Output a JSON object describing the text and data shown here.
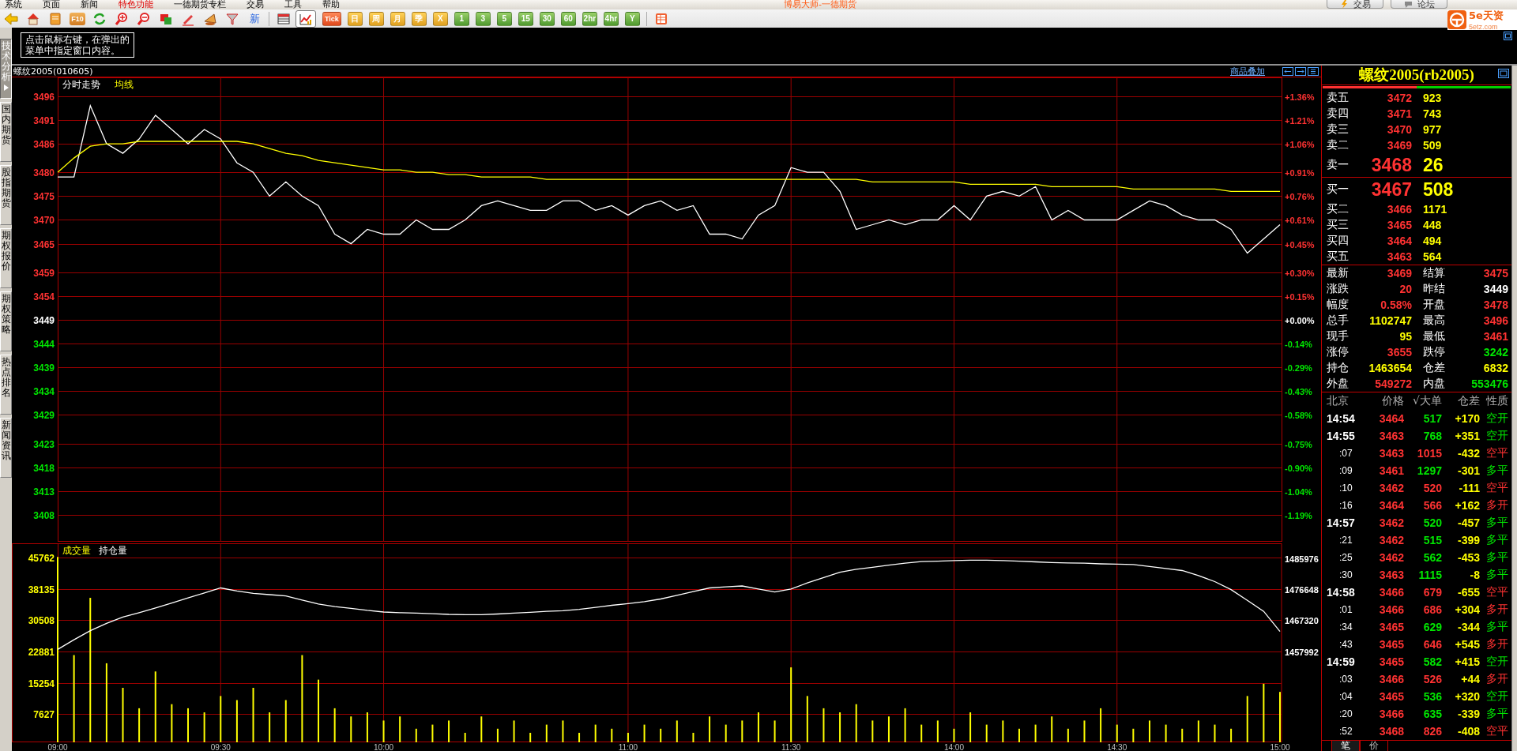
{
  "menu": {
    "items": [
      {
        "label": "系统",
        "highlight": false
      },
      {
        "label": "页面",
        "highlight": false
      },
      {
        "label": "新闻",
        "highlight": false
      },
      {
        "label": "特色功能",
        "highlight": true
      },
      {
        "label": "一德期货专栏",
        "highlight": false
      },
      {
        "label": "交易",
        "highlight": false
      },
      {
        "label": "工具",
        "highlight": false
      },
      {
        "label": "帮助",
        "highlight": false
      }
    ],
    "title": "博易大师-一德期货",
    "buttons": [
      "交易",
      "论坛"
    ]
  },
  "toolbar": {
    "f10_label": "F10",
    "news_label": "新",
    "view_pressed": true,
    "periods": [
      {
        "label": "Tick",
        "kind": "tick"
      },
      {
        "label": "日",
        "kind": "calendar"
      },
      {
        "label": "周",
        "kind": "calendar"
      },
      {
        "label": "月",
        "kind": "calendar"
      },
      {
        "label": "季",
        "kind": "calendar"
      },
      {
        "label": "X",
        "kind": "calendar"
      },
      {
        "label": "1",
        "kind": "minute"
      },
      {
        "label": "3",
        "kind": "minute"
      },
      {
        "label": "5",
        "kind": "minute"
      },
      {
        "label": "15",
        "kind": "minute"
      },
      {
        "label": "30",
        "kind": "minute"
      },
      {
        "label": "60",
        "kind": "minute"
      },
      {
        "label": "2hr",
        "kind": "minute"
      },
      {
        "label": "4hr",
        "kind": "minute"
      },
      {
        "label": "Y",
        "kind": "minute"
      }
    ]
  },
  "logo": {
    "name": "5e天资",
    "site": "5etz.com"
  },
  "side_tabs": [
    {
      "label": "技术分析",
      "selected": true
    },
    {
      "label": "国内期货",
      "selected": false
    },
    {
      "label": "股指期货",
      "selected": false
    },
    {
      "label": "期权报价",
      "selected": false
    },
    {
      "label": "期权策略",
      "selected": false
    },
    {
      "label": "热点排名",
      "selected": false
    },
    {
      "label": "新闻资讯",
      "selected": false
    }
  ],
  "hint": {
    "lines": [
      "点击鼠标右键，在弹出的",
      "菜单中指定窗口内容。"
    ]
  },
  "chart_header": {
    "title": "螺纹2005(010605)",
    "overlay_link": "商品叠加"
  },
  "price_chart": {
    "right_axis": [
      {
        "label": "+1.36%",
        "color": "#ff3232"
      },
      {
        "label": "+1.21%",
        "color": "#ff3232"
      },
      {
        "label": "+1.06%",
        "color": "#ff3232"
      },
      {
        "label": "+0.91%",
        "color": "#ff3232"
      },
      {
        "label": "+0.76%",
        "color": "#ff3232"
      },
      {
        "label": "+0.61%",
        "color": "#ff3232"
      },
      {
        "label": "+0.45%",
        "color": "#ff3232"
      },
      {
        "label": "+0.30%",
        "color": "#ff3232"
      },
      {
        "label": "+0.15%",
        "color": "#ff3232"
      },
      {
        "label": "+0.00%",
        "color": "#ffffff"
      },
      {
        "label": "-0.14%",
        "color": "#00e600"
      },
      {
        "label": "-0.29%",
        "color": "#00e600"
      },
      {
        "label": "-0.43%",
        "color": "#00e600"
      },
      {
        "label": "-0.58%",
        "color": "#00e600"
      },
      {
        "label": "-0.75%",
        "color": "#00e600"
      },
      {
        "label": "-0.90%",
        "color": "#00e600"
      },
      {
        "label": "-1.04%",
        "color": "#00e600"
      },
      {
        "label": "-1.19%",
        "color": "#00e600"
      }
    ],
    "chart_data": {
      "type": "line",
      "grid": true,
      "ylim": [
        3402.36,
        3499.95
      ],
      "yticks": [
        3496,
        3491,
        3486,
        3480,
        3475,
        3470,
        3465,
        3459,
        3454,
        3449,
        3444,
        3439,
        3434,
        3429,
        3423,
        3418,
        3413,
        3408
      ],
      "categories": [
        null,
        null,
        null,
        null,
        null,
        null,
        null,
        null,
        null,
        null,
        null,
        null,
        null,
        null,
        null,
        null,
        null,
        null,
        null,
        null,
        null,
        null,
        null,
        null,
        null,
        null,
        null,
        null,
        null,
        null,
        null,
        null,
        null,
        null,
        null,
        null,
        null,
        null,
        null,
        null,
        null,
        null,
        null,
        null,
        null,
        null,
        null,
        null,
        null,
        null,
        null,
        null,
        null,
        null,
        null,
        null,
        null,
        null,
        null,
        null,
        null,
        null,
        null,
        null,
        null,
        null,
        null,
        null,
        null,
        null,
        null,
        null,
        null,
        null,
        null,
        null
      ],
      "series": [
        {
          "name": "分时走势",
          "color": "#ffffff",
          "values": [
            3479,
            3479,
            3494,
            3486,
            3484,
            3487,
            3492,
            3489,
            3486,
            3489,
            3487,
            3482,
            3480,
            3475,
            3478,
            3475,
            3473,
            3467,
            3465,
            3468,
            3467,
            3467,
            3470,
            3468,
            3468,
            3470,
            3473,
            3474,
            3473,
            3472,
            3472,
            3474,
            3474,
            3472,
            3473,
            3471,
            3473,
            3474,
            3472,
            3473,
            3467,
            3467,
            3466,
            3471,
            3473,
            3481,
            3480,
            3480,
            3476,
            3468,
            3469,
            3470,
            3469,
            3470,
            3470,
            3473,
            3470,
            3475,
            3476,
            3475,
            3477,
            3470,
            3472,
            3470,
            3470,
            3470,
            3472,
            3474,
            3473,
            3471,
            3470,
            3470,
            3468,
            3463,
            3466,
            3469
          ]
        },
        {
          "name": "均线",
          "color": "#ffff00",
          "values": [
            3480,
            3483,
            3485.5,
            3486,
            3486,
            3486.5,
            3486.5,
            3486.5,
            3486.5,
            3486.5,
            3486.5,
            3486.5,
            3486,
            3485,
            3484,
            3483.5,
            3482.5,
            3482,
            3481.5,
            3481,
            3480.5,
            3480.5,
            3480,
            3480,
            3479.5,
            3479.5,
            3479,
            3479,
            3479,
            3479,
            3478.5,
            3478.5,
            3478.5,
            3478.5,
            3478.5,
            3478.5,
            3478.5,
            3478.5,
            3478.5,
            3478.5,
            3478.5,
            3478.5,
            3478.5,
            3478.5,
            3478.5,
            3478.5,
            3478.5,
            3478.5,
            3478.5,
            3478.5,
            3478,
            3478,
            3478,
            3478,
            3478,
            3478,
            3477.5,
            3477.5,
            3477.5,
            3477.5,
            3477.5,
            3477,
            3477,
            3477,
            3477,
            3477,
            3476.5,
            3476.5,
            3476.5,
            3476.5,
            3476.5,
            3476.5,
            3476,
            3476,
            3476,
            3476
          ]
        }
      ]
    }
  },
  "volume_chart": {
    "chart_data": {
      "type": "bar",
      "grid": true,
      "ylim": [
        676,
        49334
      ],
      "categories": [
        "09:00",
        null,
        null,
        null,
        null,
        null,
        null,
        null,
        null,
        null,
        "09:30",
        null,
        null,
        null,
        null,
        null,
        null,
        null,
        null,
        null,
        "10:00",
        null,
        null,
        null,
        null,
        null,
        null,
        null,
        null,
        null,
        null,
        null,
        null,
        null,
        null,
        "11:00",
        null,
        null,
        null,
        null,
        null,
        null,
        null,
        null,
        null,
        "11:30",
        null,
        null,
        null,
        null,
        null,
        null,
        null,
        null,
        null,
        "14:00",
        null,
        null,
        null,
        null,
        null,
        null,
        null,
        null,
        null,
        "14:30",
        null,
        null,
        null,
        null,
        null,
        null,
        null,
        null,
        null,
        "15:00"
      ],
      "yticks": [
        45762,
        38135,
        30508,
        22881,
        15254,
        7627
      ],
      "series": [
        {
          "name": "成交量",
          "color": "#ffff00",
          "values": [
            46000,
            22000,
            36000,
            20000,
            14000,
            9000,
            18000,
            10000,
            9000,
            8000,
            12000,
            11000,
            14000,
            8000,
            11000,
            22000,
            16000,
            9000,
            7000,
            8000,
            6000,
            7000,
            4000,
            5000,
            6000,
            3000,
            7000,
            4000,
            6000,
            3000,
            5000,
            6000,
            3000,
            5000,
            4000,
            3000,
            5000,
            4000,
            6000,
            3000,
            7000,
            5000,
            6000,
            8000,
            6000,
            19000,
            12000,
            9000,
            8000,
            10000,
            6000,
            7000,
            9000,
            5000,
            6000,
            4000,
            8000,
            5000,
            6000,
            4000,
            5000,
            7000,
            4000,
            6000,
            9000,
            5000,
            4000,
            6000,
            5000,
            4000,
            6000,
            5000,
            4000,
            12000,
            15000,
            13000
          ]
        }
      ]
    },
    "open_interest": {
      "chart_data": {
        "type": "line",
        "ylim": [
          1430834,
          1490345
        ],
        "yticks": [
          1485976,
          1476648,
          1467320,
          1457992
        ],
        "categories": [
          null,
          null,
          null,
          null,
          null,
          null,
          null,
          null,
          null,
          null,
          null,
          null,
          null,
          null,
          null,
          null,
          null,
          null,
          null,
          null,
          null,
          null,
          null,
          null,
          null,
          null,
          null,
          null,
          null,
          null,
          null,
          null,
          null,
          null,
          null,
          null,
          null,
          null,
          null,
          null,
          null,
          null,
          null,
          null,
          null,
          null,
          null,
          null,
          null,
          null,
          null,
          null,
          null,
          null,
          null,
          null,
          null,
          null,
          null,
          null,
          null,
          null,
          null,
          null,
          null,
          null,
          null,
          null,
          null,
          null,
          null,
          null,
          null,
          null,
          null,
          null
        ],
        "series": [
          {
            "name": "持仓量",
            "color": "#ffffff",
            "values": [
              1458600,
              1461500,
              1464200,
              1466400,
              1468300,
              1469600,
              1471000,
              1472500,
              1474000,
              1475500,
              1477000,
              1476100,
              1475400,
              1475000,
              1474600,
              1473400,
              1472200,
              1471400,
              1470900,
              1470300,
              1469800,
              1469600,
              1469500,
              1469300,
              1469100,
              1469000,
              1469000,
              1469200,
              1469500,
              1469700,
              1470000,
              1470200,
              1470600,
              1471200,
              1471800,
              1472300,
              1472900,
              1473700,
              1474800,
              1475900,
              1477000,
              1477300,
              1477600,
              1476700,
              1475800,
              1476700,
              1478500,
              1480100,
              1481700,
              1482600,
              1483200,
              1483800,
              1484400,
              1484900,
              1485000,
              1485200,
              1485300,
              1485300,
              1485200,
              1485000,
              1484800,
              1484600,
              1484500,
              1484400,
              1484200,
              1484100,
              1484000,
              1483400,
              1482800,
              1482200,
              1480700,
              1478900,
              1476500,
              1473300,
              1470000,
              1464000
            ]
          }
        ]
      }
    }
  },
  "quote": {
    "title": "螺纹2005(rb2005)",
    "ratio": {
      "level": 0.5
    },
    "asks": [
      {
        "label": "卖五",
        "price": "3472",
        "volume": "923",
        "kind": "depth"
      },
      {
        "label": "卖四",
        "price": "3471",
        "volume": "743",
        "kind": "depth"
      },
      {
        "label": "卖三",
        "price": "3470",
        "volume": "977",
        "kind": "depth"
      },
      {
        "label": "卖二",
        "price": "3469",
        "volume": "509",
        "kind": "depth"
      },
      {
        "label": "卖一",
        "price": "3468",
        "volume": "26",
        "kind": "best"
      }
    ],
    "bids": [
      {
        "label": "买一",
        "price": "3467",
        "volume": "508",
        "kind": "best"
      },
      {
        "label": "买二",
        "price": "3466",
        "volume": "1171",
        "kind": "depth"
      },
      {
        "label": "买三",
        "price": "3465",
        "volume": "448",
        "kind": "depth"
      },
      {
        "label": "买四",
        "price": "3464",
        "volume": "494",
        "kind": "depth"
      },
      {
        "label": "买五",
        "price": "3463",
        "volume": "564",
        "kind": "depth"
      }
    ],
    "stats": [
      {
        "label": "最新",
        "value": "3469",
        "color": "#ff3232"
      },
      {
        "label": "结算",
        "value": "3475",
        "color": "#ff3232"
      },
      {
        "label": "涨跌",
        "value": "20",
        "color": "#ff3232"
      },
      {
        "label": "昨结",
        "value": "3449",
        "color": "#ffffff"
      },
      {
        "label": "幅度",
        "value": "0.58%",
        "color": "#ff3232"
      },
      {
        "label": "开盘",
        "value": "3478",
        "color": "#ff3232"
      },
      {
        "label": "总手",
        "value": "1102747",
        "color": "#ffff00"
      },
      {
        "label": "最高",
        "value": "3496",
        "color": "#ff3232"
      },
      {
        "label": "现手",
        "value": "95",
        "color": "#ffff00"
      },
      {
        "label": "最低",
        "value": "3461",
        "color": "#ff3232"
      },
      {
        "label": "涨停",
        "value": "3655",
        "color": "#ff3232"
      },
      {
        "label": "跌停",
        "value": "3242",
        "color": "#00e600"
      },
      {
        "label": "持仓",
        "value": "1463654",
        "color": "#ffff00"
      },
      {
        "label": "仓差",
        "value": "6832",
        "color": "#ffff00"
      },
      {
        "label": "外盘",
        "value": "549272",
        "color": "#ff3232"
      },
      {
        "label": "内盘",
        "value": "553476",
        "color": "#00e600"
      }
    ]
  },
  "trades": {
    "columns": [
      "北京",
      "价格",
      "√大单",
      "仓差",
      "性质"
    ],
    "rows": [
      {
        "kind": "minute",
        "time": "14:54",
        "price": "3464",
        "volume": "517",
        "oi": "+170",
        "nature": "空开",
        "color": "#00e600"
      },
      {
        "kind": "minute",
        "time": "14:55",
        "price": "3463",
        "volume": "768",
        "oi": "+351",
        "nature": "空开",
        "color": "#00e600"
      },
      {
        "kind": "second",
        "time": ":07",
        "price": "3463",
        "volume": "1015",
        "oi": "-432",
        "nature": "空平",
        "color": "#ff3232"
      },
      {
        "kind": "second",
        "time": ":09",
        "price": "3461",
        "volume": "1297",
        "oi": "-301",
        "nature": "多平",
        "color": "#00e600"
      },
      {
        "kind": "second",
        "time": ":10",
        "price": "3462",
        "volume": "520",
        "oi": "-111",
        "nature": "空平",
        "color": "#ff3232"
      },
      {
        "kind": "second",
        "time": ":16",
        "price": "3464",
        "volume": "566",
        "oi": "+162",
        "nature": "多开",
        "color": "#ff3232"
      },
      {
        "kind": "minute",
        "time": "14:57",
        "price": "3462",
        "volume": "520",
        "oi": "-457",
        "nature": "多平",
        "color": "#00e600"
      },
      {
        "kind": "second",
        "time": ":21",
        "price": "3462",
        "volume": "515",
        "oi": "-399",
        "nature": "多平",
        "color": "#00e600"
      },
      {
        "kind": "second",
        "time": ":25",
        "price": "3462",
        "volume": "562",
        "oi": "-453",
        "nature": "多平",
        "color": "#00e600"
      },
      {
        "kind": "second",
        "time": ":30",
        "price": "3463",
        "volume": "1115",
        "oi": "-8",
        "nature": "多平",
        "color": "#00e600"
      },
      {
        "kind": "minute",
        "time": "14:58",
        "price": "3466",
        "volume": "679",
        "oi": "-655",
        "nature": "空平",
        "color": "#ff3232"
      },
      {
        "kind": "second",
        "time": ":01",
        "price": "3466",
        "volume": "686",
        "oi": "+304",
        "nature": "多开",
        "color": "#ff3232"
      },
      {
        "kind": "second",
        "time": ":34",
        "price": "3465",
        "volume": "629",
        "oi": "-344",
        "nature": "多平",
        "color": "#00e600"
      },
      {
        "kind": "second",
        "time": ":43",
        "price": "3465",
        "volume": "646",
        "oi": "+545",
        "nature": "多开",
        "color": "#ff3232"
      },
      {
        "kind": "minute",
        "time": "14:59",
        "price": "3465",
        "volume": "582",
        "oi": "+415",
        "nature": "空开",
        "color": "#00e600"
      },
      {
        "kind": "second",
        "time": ":03",
        "price": "3466",
        "volume": "526",
        "oi": "+44",
        "nature": "多开",
        "color": "#ff3232"
      },
      {
        "kind": "second",
        "time": ":04",
        "price": "3465",
        "volume": "536",
        "oi": "+320",
        "nature": "空开",
        "color": "#00e600"
      },
      {
        "kind": "second",
        "time": ":20",
        "price": "3466",
        "volume": "635",
        "oi": "-339",
        "nature": "多平",
        "color": "#00e600"
      },
      {
        "kind": "second",
        "time": ":52",
        "price": "3468",
        "volume": "826",
        "oi": "-408",
        "nature": "空平",
        "color": "#ff3232"
      }
    ]
  },
  "bottom_tabs": [
    {
      "label": "笔",
      "selected": true
    },
    {
      "label": "价",
      "selected": false
    }
  ]
}
